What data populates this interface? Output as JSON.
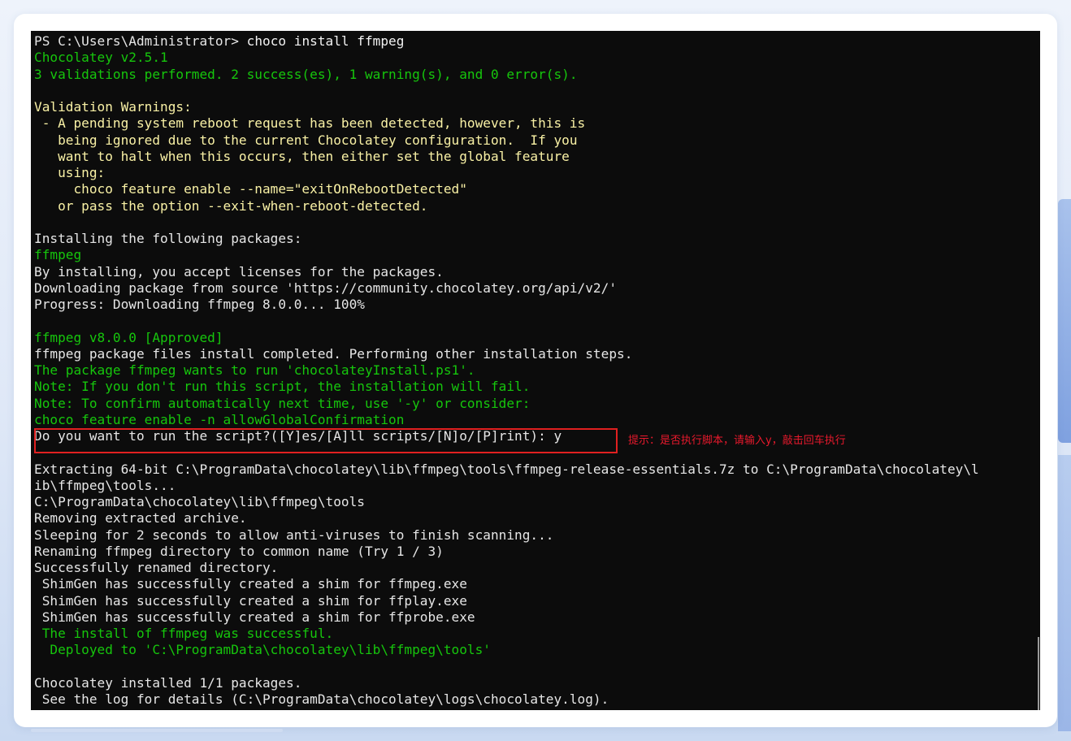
{
  "terminal": {
    "lines": [
      {
        "text": "PS C:\\Users\\Administrator> ",
        "cmd": "choco install ffmpeg",
        "color": "default"
      },
      {
        "text": "Chocolatey v2.5.1",
        "color": "green"
      },
      {
        "text": "3 validations performed. 2 success(es), 1 warning(s), and 0 error(s).",
        "color": "green"
      },
      {
        "text": "",
        "color": "default"
      },
      {
        "text": "Validation Warnings:",
        "color": "yellow"
      },
      {
        "text": " - A pending system reboot request has been detected, however, this is",
        "color": "yellow"
      },
      {
        "text": "   being ignored due to the current Chocolatey configuration.  If you",
        "color": "yellow"
      },
      {
        "text": "   want to halt when this occurs, then either set the global feature",
        "color": "yellow"
      },
      {
        "text": "   using:",
        "color": "yellow"
      },
      {
        "text": "     choco feature enable --name=\"exitOnRebootDetected\"",
        "color": "yellow"
      },
      {
        "text": "   or pass the option --exit-when-reboot-detected.",
        "color": "yellow"
      },
      {
        "text": "",
        "color": "default"
      },
      {
        "text": "Installing the following packages:",
        "color": "default"
      },
      {
        "text": "ffmpeg",
        "color": "green"
      },
      {
        "text": "By installing, you accept licenses for the packages.",
        "color": "default"
      },
      {
        "text": "Downloading package from source 'https://community.chocolatey.org/api/v2/'",
        "color": "default"
      },
      {
        "text": "Progress: Downloading ffmpeg 8.0.0... 100%",
        "color": "default"
      },
      {
        "text": "",
        "color": "default"
      },
      {
        "text": "ffmpeg v8.0.0 [Approved]",
        "color": "green"
      },
      {
        "text": "ffmpeg package files install completed. Performing other installation steps.",
        "color": "default"
      },
      {
        "text": "The package ffmpeg wants to run 'chocolateyInstall.ps1'.",
        "color": "green"
      },
      {
        "text": "Note: If you don't run this script, the installation will fail.",
        "color": "green"
      },
      {
        "text": "Note: To confirm automatically next time, use '-y' or consider:",
        "color": "green"
      },
      {
        "text": "choco feature enable -n allowGlobalConfirmation",
        "color": "green"
      },
      {
        "text": "Do you want to run the script?([Y]es/[A]ll scripts/[N]o/[P]rint): y",
        "color": "default"
      },
      {
        "text": "",
        "color": "default"
      },
      {
        "text": "Extracting 64-bit C:\\ProgramData\\chocolatey\\lib\\ffmpeg\\tools\\ffmpeg-release-essentials.7z to C:\\ProgramData\\chocolatey\\l",
        "color": "default"
      },
      {
        "text": "ib\\ffmpeg\\tools...",
        "color": "default"
      },
      {
        "text": "C:\\ProgramData\\chocolatey\\lib\\ffmpeg\\tools",
        "color": "default"
      },
      {
        "text": "Removing extracted archive.",
        "color": "default"
      },
      {
        "text": "Sleeping for 2 seconds to allow anti-viruses to finish scanning...",
        "color": "default"
      },
      {
        "text": "Renaming ffmpeg directory to common name (Try 1 / 3)",
        "color": "default"
      },
      {
        "text": "Successfully renamed directory.",
        "color": "default"
      },
      {
        "text": " ShimGen has successfully created a shim for ffmpeg.exe",
        "color": "default"
      },
      {
        "text": " ShimGen has successfully created a shim for ffplay.exe",
        "color": "default"
      },
      {
        "text": " ShimGen has successfully created a shim for ffprobe.exe",
        "color": "default"
      },
      {
        "text": " The install of ffmpeg was successful.",
        "color": "green"
      },
      {
        "text": "  Deployed to 'C:\\ProgramData\\chocolatey\\lib\\ffmpeg\\tools'",
        "color": "green"
      },
      {
        "text": "",
        "color": "default"
      },
      {
        "text": "Chocolatey installed 1/1 packages.",
        "color": "default"
      },
      {
        "text": " See the log for details (C:\\ProgramData\\chocolatey\\logs\\chocolatey.log).",
        "color": "default"
      }
    ]
  },
  "annotation": {
    "text": "提示：是否执行脚本，请输入y，敲击回车执行"
  },
  "colors": {
    "terminal_bg": "#0c0c0c",
    "default_text": "#e6e6e6",
    "green": "#16c60c",
    "yellow": "#f9f1a5",
    "highlight_border": "#e02020",
    "annotation": "#e8192c"
  }
}
